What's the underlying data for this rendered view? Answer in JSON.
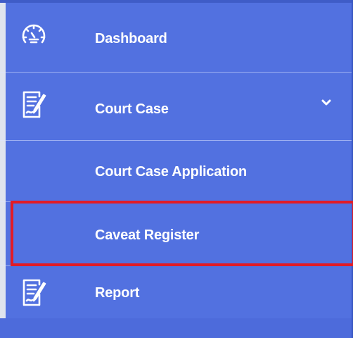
{
  "sidebar": {
    "items": [
      {
        "label": "Dashboard",
        "icon": "speedometer-icon"
      },
      {
        "label": "Court Case",
        "icon": "document-edit-icon",
        "expanded": true,
        "children": [
          {
            "label": "Court Case Application"
          },
          {
            "label": "Caveat Register",
            "highlighted": true
          }
        ]
      },
      {
        "label": "Report",
        "icon": "document-edit-icon"
      }
    ]
  },
  "colors": {
    "sidebar_bg": "#5271e0",
    "text": "#ffffff",
    "highlight_border": "#e21b25"
  }
}
